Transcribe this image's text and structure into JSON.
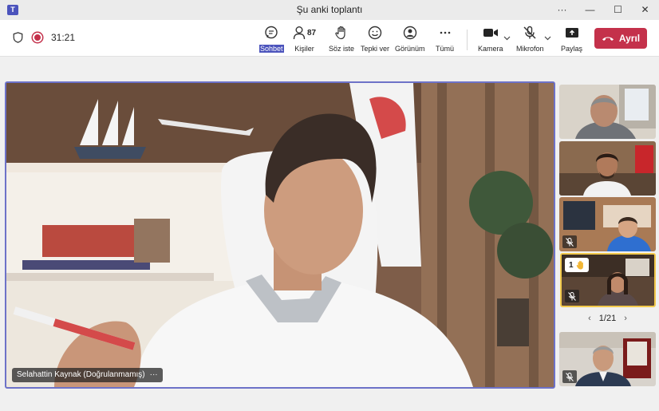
{
  "window": {
    "title": "Şu anki toplantı",
    "app_icon": "teams-icon",
    "more": "···",
    "minimize": "—",
    "maximize": "☐",
    "close": "✕"
  },
  "toolbar": {
    "timer": "31:21",
    "buttons": [
      {
        "key": "chat",
        "label": "Sohbet",
        "icon": "chat-icon",
        "selected": true
      },
      {
        "key": "people",
        "label": "Kişiler",
        "icon": "people-icon",
        "count": "87"
      },
      {
        "key": "raise",
        "label": "Söz iste",
        "icon": "raise-hand-icon"
      },
      {
        "key": "react",
        "label": "Tepki ver",
        "icon": "smile-icon"
      },
      {
        "key": "view",
        "label": "Görünüm",
        "icon": "view-icon"
      },
      {
        "key": "more",
        "label": "Tümü",
        "icon": "more-icon"
      },
      {
        "key": "camera",
        "label": "Kamera",
        "icon": "camera-icon"
      },
      {
        "key": "mic",
        "label": "Mikrofon",
        "icon": "mic-off-icon"
      },
      {
        "key": "share",
        "label": "Paylaş",
        "icon": "share-icon"
      }
    ],
    "leave_label": "Ayrıl",
    "leave_color": "#c4314b"
  },
  "stage": {
    "speaker_name": "Selahattin Kaynak (Doğrulanmamış)",
    "more": "···"
  },
  "thumbnails": [
    {
      "key": "p1",
      "muted": false
    },
    {
      "key": "p2",
      "muted": false
    },
    {
      "key": "p3",
      "muted": true
    },
    {
      "key": "p4",
      "muted": true,
      "raised_hand": "1",
      "active": true
    },
    {
      "key": "p5",
      "muted": true
    }
  ],
  "pager": {
    "label": "1/21",
    "prev": "‹",
    "next": "›"
  },
  "colors": {
    "accent": "#4b53bc",
    "stage_border": "#6d72c8",
    "active_speaker": "#f2c94c"
  }
}
